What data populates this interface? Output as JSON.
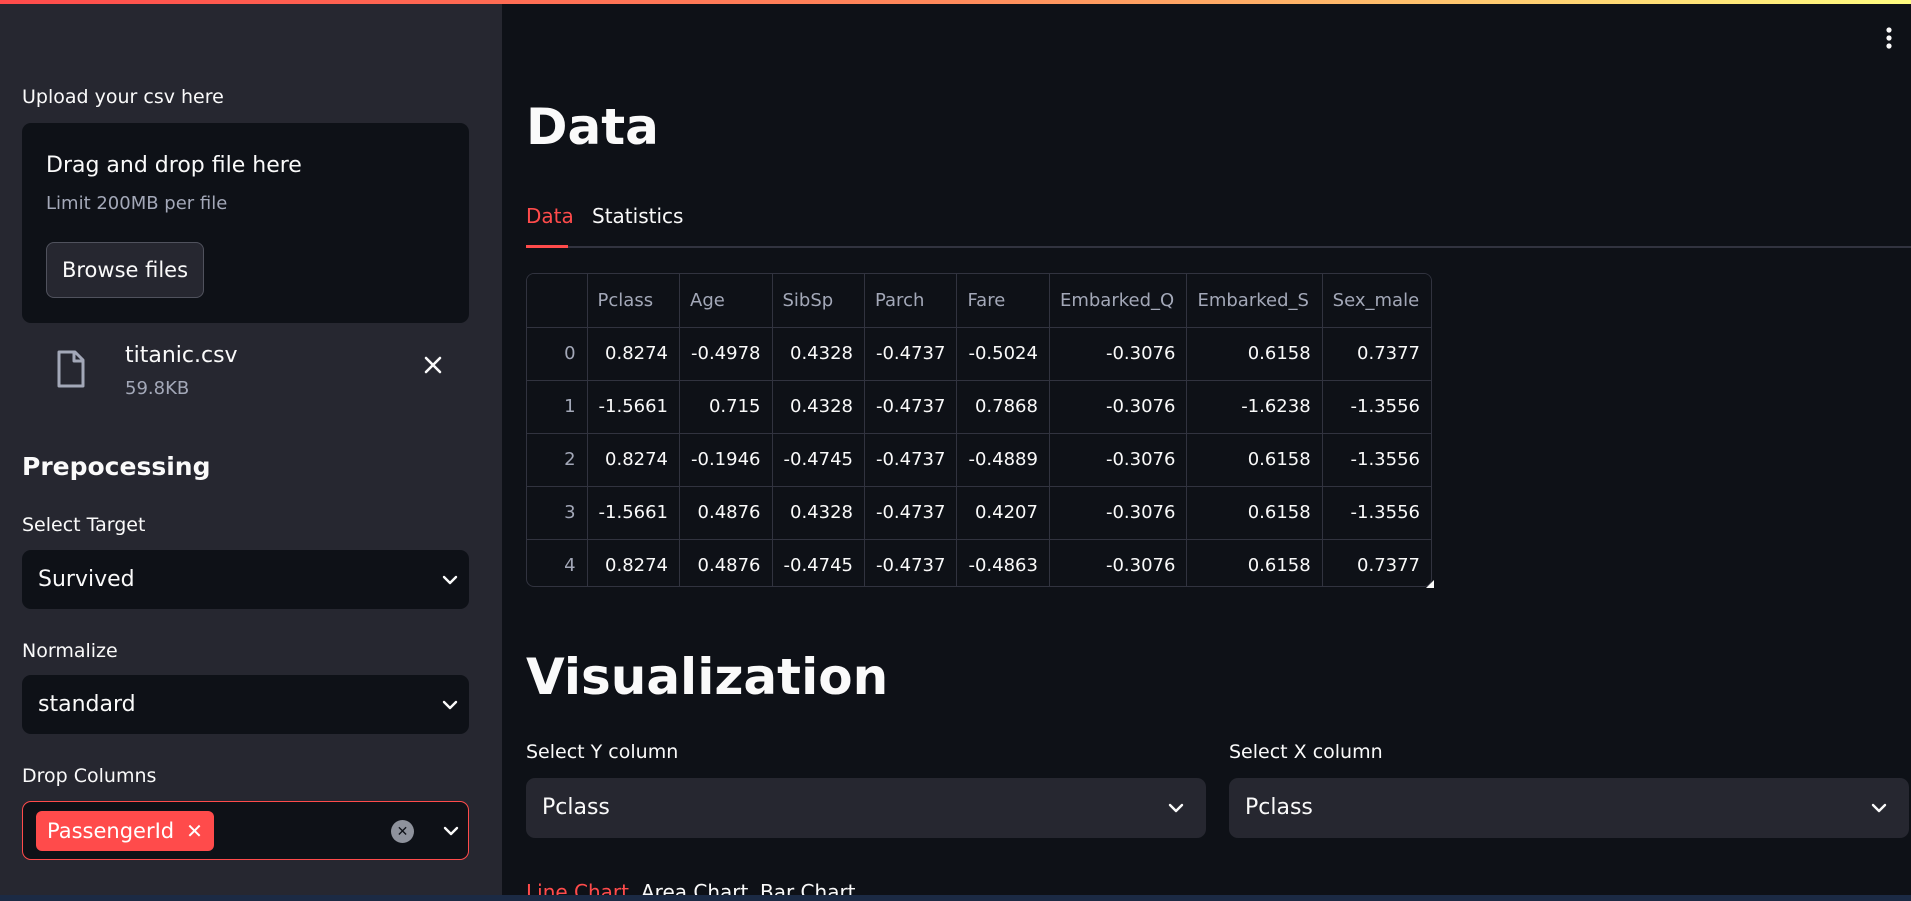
{
  "sidebar": {
    "upload_label": "Upload your csv here",
    "dropzone": {
      "title": "Drag and drop file here",
      "limit": "Limit 200MB per file",
      "browse_label": "Browse files"
    },
    "file": {
      "name": "titanic.csv",
      "size": "59.8KB"
    },
    "section_title": "Prepocessing",
    "target": {
      "label": "Select Target",
      "value": "Survived"
    },
    "normalize": {
      "label": "Normalize",
      "value": "standard"
    },
    "drop_columns": {
      "label": "Drop Columns",
      "tags": [
        "PassengerId"
      ]
    }
  },
  "main": {
    "data_title": "Data",
    "tabs": [
      {
        "label": "Data",
        "active": true
      },
      {
        "label": "Statistics",
        "active": false
      }
    ],
    "table": {
      "columns": [
        "",
        "Pclass",
        "Age",
        "SibSp",
        "Parch",
        "Fare",
        "Embarked_Q",
        "Embarked_S",
        "Sex_male"
      ],
      "rows": [
        [
          "0",
          "0.8274",
          "-0.4978",
          "0.4328",
          "-0.4737",
          "-0.5024",
          "-0.3076",
          "0.6158",
          "0.7377"
        ],
        [
          "1",
          "-1.5661",
          "0.715",
          "0.4328",
          "-0.4737",
          "0.7868",
          "-0.3076",
          "-1.6238",
          "-1.3556"
        ],
        [
          "2",
          "0.8274",
          "-0.1946",
          "-0.4745",
          "-0.4737",
          "-0.4889",
          "-0.3076",
          "0.6158",
          "-1.3556"
        ],
        [
          "3",
          "-1.5661",
          "0.4876",
          "0.4328",
          "-0.4737",
          "0.4207",
          "-0.3076",
          "0.6158",
          "-1.3556"
        ],
        [
          "4",
          "0.8274",
          "0.4876",
          "-0.4745",
          "-0.4737",
          "-0.4863",
          "-0.3076",
          "0.6158",
          "0.7377"
        ]
      ]
    },
    "viz_title": "Visualization",
    "y_select": {
      "label": "Select Y column",
      "value": "Pclass"
    },
    "x_select": {
      "label": "Select X column",
      "value": "Pclass"
    },
    "chart_tabs": [
      {
        "label": "Line Chart",
        "active": true
      },
      {
        "label": "Area Chart",
        "active": false
      },
      {
        "label": "Bar Chart",
        "active": false
      }
    ]
  },
  "colors": {
    "accent": "#ff4b4b",
    "sidebar_bg": "#262730",
    "main_bg": "#0e1117"
  }
}
